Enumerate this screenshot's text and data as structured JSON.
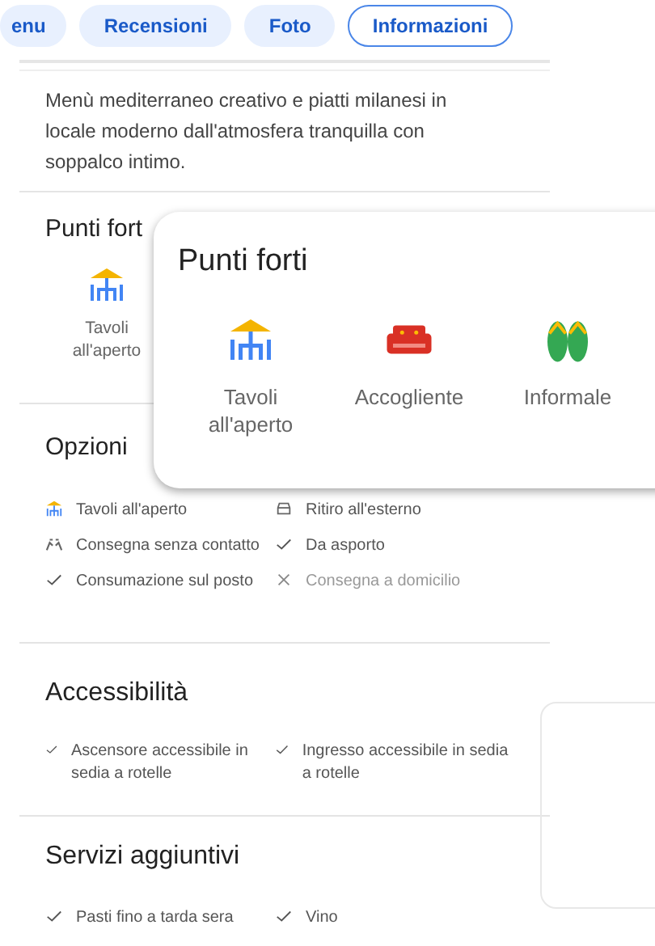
{
  "tabs": [
    {
      "label": "enu",
      "selected": false
    },
    {
      "label": "Recensioni",
      "selected": false
    },
    {
      "label": "Foto",
      "selected": false
    },
    {
      "label": "Informazioni",
      "selected": true
    }
  ],
  "description": "Menù mediterraneo creativo e piatti milanesi in locale moderno dall'atmosfera tranquilla con soppalco intimo.",
  "highlights": {
    "title": "Punti fort",
    "items": [
      {
        "kind": "outdoor",
        "label": "Tavoli all'aperto"
      }
    ]
  },
  "options": {
    "title": "Opzioni",
    "items": [
      {
        "kind": "outdoor",
        "label": "Tavoli all'aperto"
      },
      {
        "kind": "pickup",
        "label": "Ritiro all'esterno"
      },
      {
        "kind": "contactless",
        "label": "Consegna senza contatto"
      },
      {
        "kind": "check",
        "label": "Da asporto"
      },
      {
        "kind": "check",
        "label": "Consumazione sul posto"
      },
      {
        "kind": "cross",
        "label": "Consegna a domicilio"
      }
    ]
  },
  "accessibility": {
    "title": "Accessibilità",
    "items": [
      {
        "kind": "check",
        "label": "Ascensore accessibile in sedia a rotelle"
      },
      {
        "kind": "check",
        "label": "Ingresso accessibile in sedia a rotelle"
      }
    ]
  },
  "services": {
    "title": "Servizi aggiuntivi",
    "items": [
      {
        "kind": "check",
        "label": "Pasti fino a tarda sera"
      },
      {
        "kind": "check",
        "label": "Vino"
      }
    ]
  },
  "popup": {
    "title": "Punti forti",
    "items": [
      {
        "kind": "outdoor",
        "label": "Tavoli all'aperto"
      },
      {
        "kind": "cozy",
        "label": "Accogliente"
      },
      {
        "kind": "casual",
        "label": "Informale"
      }
    ]
  }
}
